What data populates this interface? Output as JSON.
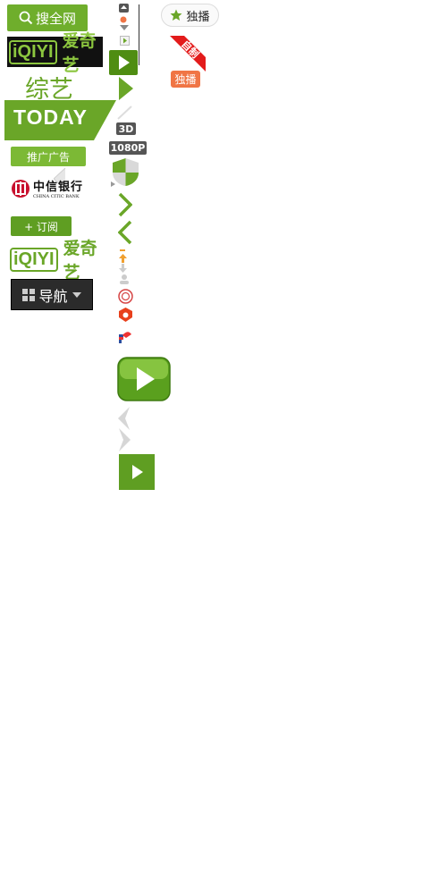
{
  "search": {
    "label": "搜全网",
    "icon": "search-icon"
  },
  "logo": {
    "mark": "iQIYI",
    "name": "爱奇艺"
  },
  "channel": {
    "label": "综艺"
  },
  "today": {
    "label": "TODAY"
  },
  "promo": {
    "label": "推广广告"
  },
  "sponsor": {
    "name_cn": "中信银行",
    "name_en": "CHINA CITIC BANK"
  },
  "subscribe": {
    "label": "+ 订阅"
  },
  "nav": {
    "label": "导航"
  },
  "badges": {
    "exclusive": "独播",
    "self_made": "自制",
    "exclusive_tag": "独播",
    "res_3d": "3D",
    "res_1080": "1080P"
  },
  "colors": {
    "brand_green": "#6aa628",
    "dark": "#2b2b2b",
    "red": "#e31b1b",
    "orange": "#f07545"
  }
}
